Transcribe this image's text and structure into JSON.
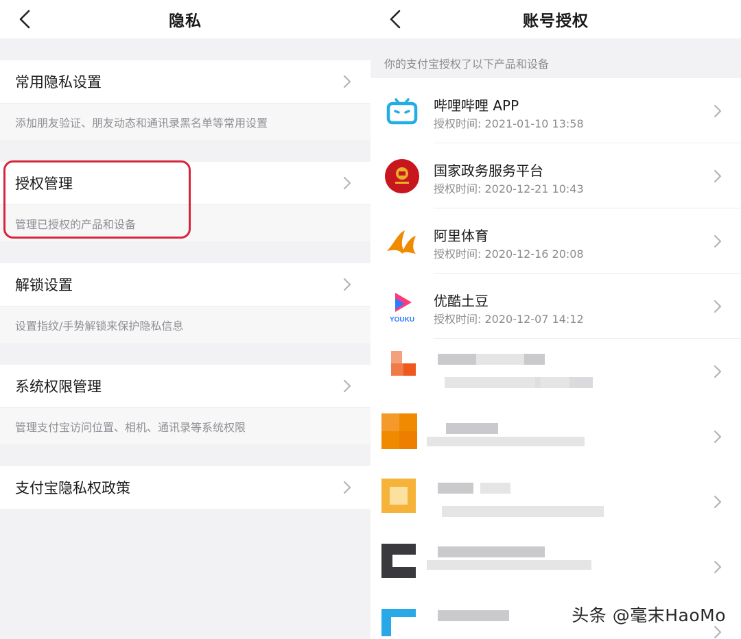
{
  "left": {
    "title": "隐私",
    "sections": [
      {
        "label": "常用隐私设置",
        "desc": "添加朋友验证、朋友动态和通讯录黑名单等常用设置"
      },
      {
        "label": "授权管理",
        "desc": "管理已授权的产品和设备"
      },
      {
        "label": "解锁设置",
        "desc": "设置指纹/手势解锁来保护隐私信息"
      },
      {
        "label": "系统权限管理",
        "desc": "管理支付宝访问位置、相机、通讯录等系统权限"
      },
      {
        "label": "支付宝隐私权政策",
        "desc": ""
      }
    ],
    "highlight_color": "#d8243a"
  },
  "right": {
    "title": "账号授权",
    "subheading": "你的支付宝授权了以下产品和设备",
    "items": [
      {
        "name": "哔哩哔哩 APP",
        "time": "授权时间: 2021-01-10 13:58",
        "icon": "bilibili-icon"
      },
      {
        "name": "国家政务服务平台",
        "time": "授权时间: 2020-12-21 10:43",
        "icon": "gov-service-emblem-icon"
      },
      {
        "name": "阿里体育",
        "time": "授权时间: 2020-12-16 20:08",
        "icon": "ali-sports-icon"
      },
      {
        "name": "优酷土豆",
        "time": "授权时间: 2020-12-07 14:12",
        "icon": "youku-icon"
      }
    ],
    "blurred_item_count": 5,
    "icon_text": {
      "youku": "YOUKU"
    },
    "colors": {
      "bilibili": "#23ade5",
      "gov": "#c8161e",
      "ali_sports": "#f08a00",
      "youku_pink": "#ff3a7a",
      "youku_blue": "#2f7bff"
    }
  },
  "watermark": "头条 @毫末HaoMo"
}
